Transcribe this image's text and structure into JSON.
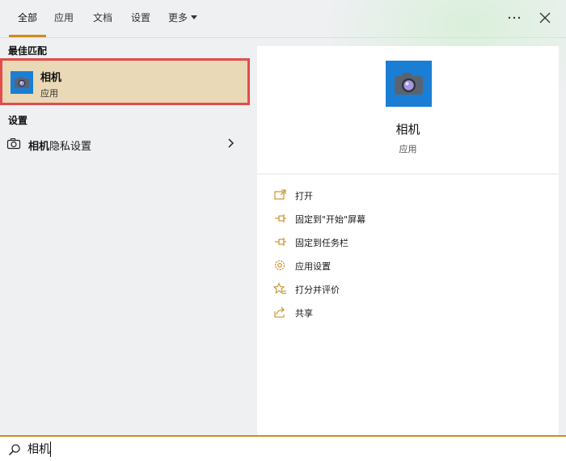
{
  "tabs": [
    {
      "label": "全部",
      "active": true
    },
    {
      "label": "应用"
    },
    {
      "label": "文档"
    },
    {
      "label": "设置"
    },
    {
      "label": "更多"
    }
  ],
  "toolbar": {
    "more_options_icon": "ellipsis-icon",
    "close_icon": "close-icon"
  },
  "best_match": {
    "section_title": "最佳匹配",
    "name": "相机",
    "type": "应用",
    "icon": "camera-icon"
  },
  "settings": {
    "section_title": "设置",
    "item": {
      "label_bold": "相机",
      "label_rest": "隐私设置",
      "icon": "camera-outline-icon"
    }
  },
  "detail": {
    "name": "相机",
    "type": "应用",
    "icon": "camera-icon",
    "actions": [
      {
        "label": "打开",
        "icon": "open-icon"
      },
      {
        "label": "固定到\"开始\"屏幕",
        "icon": "pin-icon"
      },
      {
        "label": "固定到任务栏",
        "icon": "pin-icon"
      },
      {
        "label": "应用设置",
        "icon": "gear-icon"
      },
      {
        "label": "打分并评价",
        "icon": "star-icon"
      },
      {
        "label": "共享",
        "icon": "share-icon"
      }
    ]
  },
  "search": {
    "value": "相机",
    "icon": "search-icon"
  },
  "colors": {
    "accent": "#d28a1a",
    "selection_bg": "#e9d9b6",
    "selection_border": "#e24c4b",
    "app_icon_bg": "#1a7ed4"
  }
}
